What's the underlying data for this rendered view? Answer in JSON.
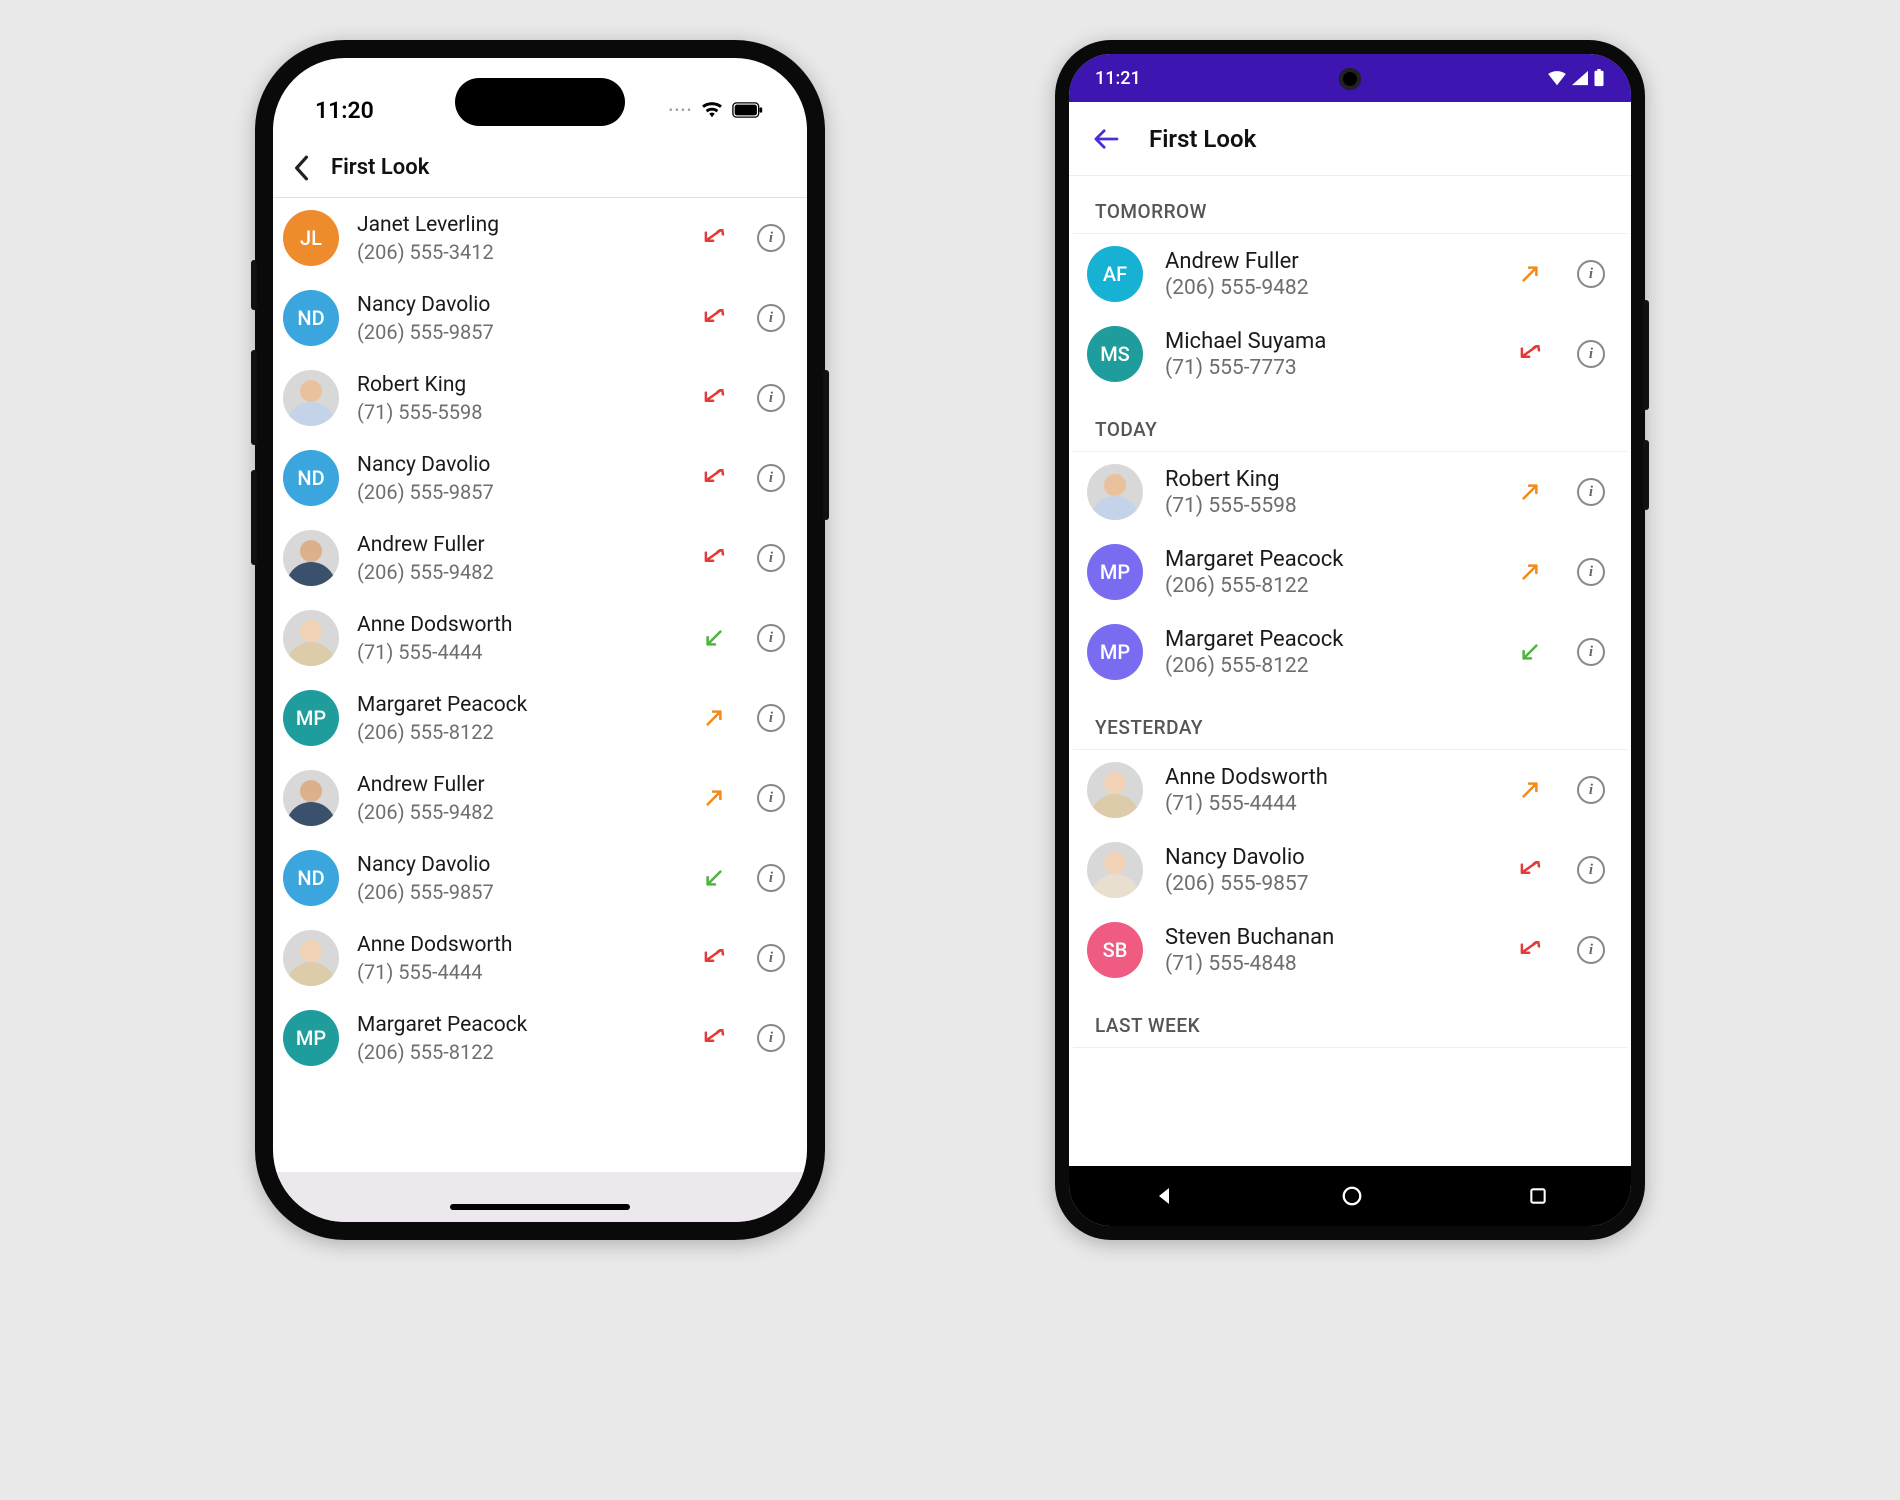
{
  "ios": {
    "status_time": "11:20",
    "nav_title": "First Look",
    "contacts": [
      {
        "name": "Janet Leverling",
        "phone": "(206) 555-3412",
        "avatar": {
          "kind": "initials",
          "text": "JL",
          "color": "bg-orange"
        },
        "call": "missed"
      },
      {
        "name": "Nancy Davolio",
        "phone": "(206) 555-9857",
        "avatar": {
          "kind": "initials",
          "text": "ND",
          "color": "bg-blue"
        },
        "call": "missed"
      },
      {
        "name": "Robert King",
        "phone": "(71) 555-5598",
        "avatar": {
          "kind": "photo",
          "variant": "m1"
        },
        "call": "missed"
      },
      {
        "name": "Nancy Davolio",
        "phone": "(206) 555-9857",
        "avatar": {
          "kind": "initials",
          "text": "ND",
          "color": "bg-blue"
        },
        "call": "missed"
      },
      {
        "name": "Andrew Fuller",
        "phone": "(206) 555-9482",
        "avatar": {
          "kind": "photo",
          "variant": "m2"
        },
        "call": "missed"
      },
      {
        "name": "Anne Dodsworth",
        "phone": "(71) 555-4444",
        "avatar": {
          "kind": "photo",
          "variant": "f1"
        },
        "call": "incoming"
      },
      {
        "name": "Margaret Peacock",
        "phone": "(206) 555-8122",
        "avatar": {
          "kind": "initials",
          "text": "MP",
          "color": "bg-teal"
        },
        "call": "outgoing"
      },
      {
        "name": "Andrew Fuller",
        "phone": "(206) 555-9482",
        "avatar": {
          "kind": "photo",
          "variant": "m2"
        },
        "call": "outgoing"
      },
      {
        "name": "Nancy Davolio",
        "phone": "(206) 555-9857",
        "avatar": {
          "kind": "initials",
          "text": "ND",
          "color": "bg-blue"
        },
        "call": "incoming"
      },
      {
        "name": "Anne Dodsworth",
        "phone": "(71) 555-4444",
        "avatar": {
          "kind": "photo",
          "variant": "f1"
        },
        "call": "missed"
      },
      {
        "name": "Margaret Peacock",
        "phone": "(206) 555-8122",
        "avatar": {
          "kind": "initials",
          "text": "MP",
          "color": "bg-teal"
        },
        "call": "missed"
      }
    ]
  },
  "android": {
    "status_time": "11:21",
    "nav_title": "First Look",
    "sections": [
      {
        "title": "TOMORROW",
        "items": [
          {
            "name": "Andrew Fuller",
            "phone": "(206) 555-9482",
            "avatar": {
              "kind": "initials",
              "text": "AF",
              "color": "bg-cyan"
            },
            "call": "outgoing"
          },
          {
            "name": "Michael Suyama",
            "phone": "(71) 555-7773",
            "avatar": {
              "kind": "initials",
              "text": "MS",
              "color": "bg-teal"
            },
            "call": "missed"
          }
        ]
      },
      {
        "title": "TODAY",
        "items": [
          {
            "name": "Robert King",
            "phone": "(71) 555-5598",
            "avatar": {
              "kind": "photo",
              "variant": "m1"
            },
            "call": "outgoing"
          },
          {
            "name": "Margaret Peacock",
            "phone": "(206) 555-8122",
            "avatar": {
              "kind": "initials",
              "text": "MP",
              "color": "bg-purple"
            },
            "call": "outgoing"
          },
          {
            "name": "Margaret Peacock",
            "phone": "(206) 555-8122",
            "avatar": {
              "kind": "initials",
              "text": "MP",
              "color": "bg-purple"
            },
            "call": "incoming"
          }
        ]
      },
      {
        "title": "YESTERDAY",
        "items": [
          {
            "name": "Anne Dodsworth",
            "phone": "(71) 555-4444",
            "avatar": {
              "kind": "photo",
              "variant": "f1"
            },
            "call": "outgoing"
          },
          {
            "name": "Nancy Davolio",
            "phone": "(206) 555-9857",
            "avatar": {
              "kind": "photo",
              "variant": "f2"
            },
            "call": "missed"
          },
          {
            "name": "Steven Buchanan",
            "phone": "(71) 555-4848",
            "avatar": {
              "kind": "initials",
              "text": "SB",
              "color": "bg-pink"
            },
            "call": "missed"
          }
        ]
      },
      {
        "title": "LAST WEEK",
        "items": []
      }
    ]
  }
}
